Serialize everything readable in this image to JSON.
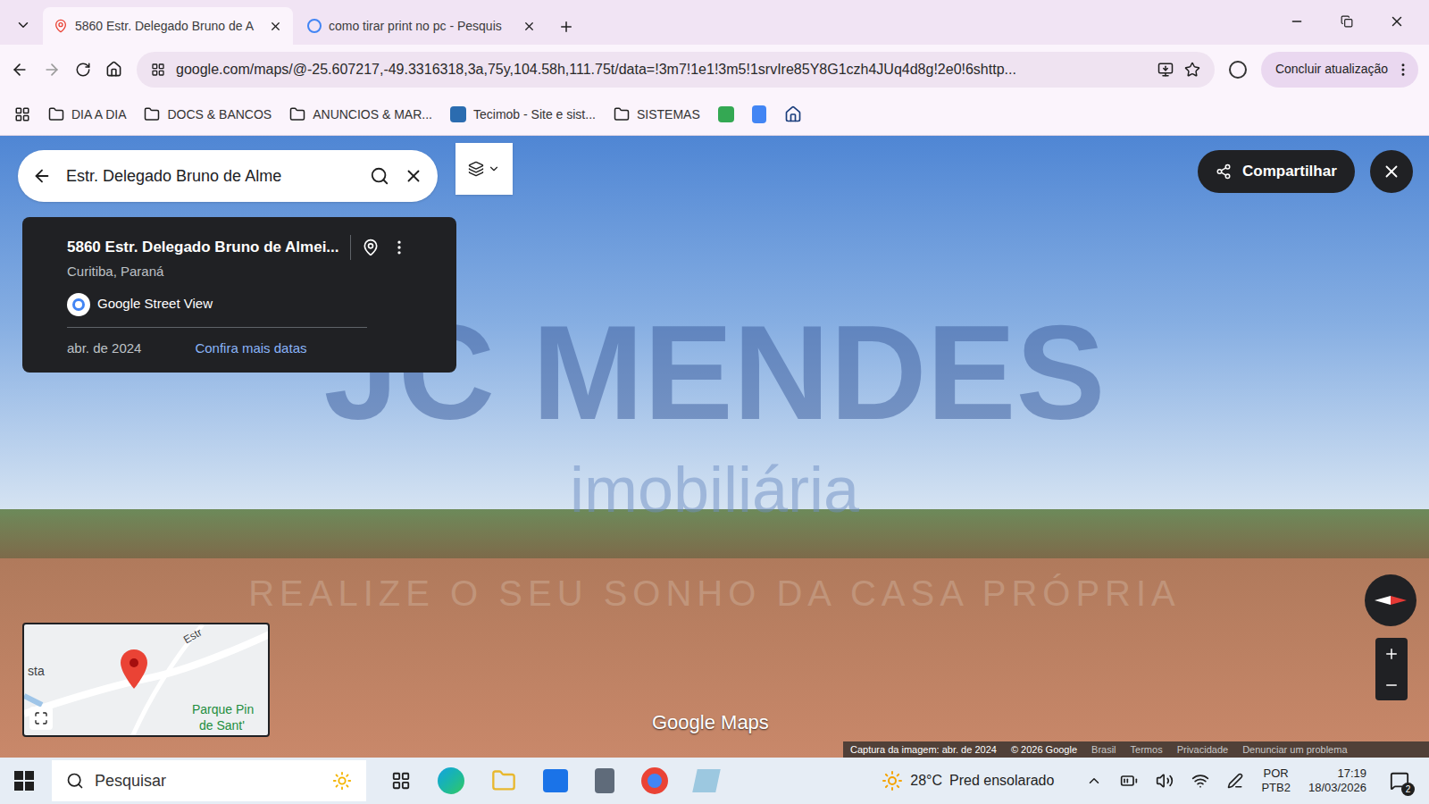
{
  "browser": {
    "tabs": [
      {
        "label": "5860 Estr. Delegado Bruno de A",
        "selected": true
      },
      {
        "label": "como tirar print no pc - Pesquis",
        "selected": false
      }
    ],
    "url": "google.com/maps/@-25.607217,-49.3316318,3a,75y,104.58h,111.75t/data=!3m7!1e1!3m5!1srvIre85Y8G1czh4JUq4d8g!2e0!6shttp...",
    "update_button": "Concluir atualização",
    "bookmarks": [
      {
        "label": "DIA A DIA",
        "kind": "folder"
      },
      {
        "label": "DOCS & BANCOS",
        "kind": "folder"
      },
      {
        "label": "ANUNCIOS & MAR...",
        "kind": "folder"
      },
      {
        "label": "Tecimob - Site e sist...",
        "kind": "site"
      },
      {
        "label": "SISTEMAS",
        "kind": "folder"
      }
    ]
  },
  "maps": {
    "search_value": "Estr. Delegado Bruno de Alme",
    "card": {
      "title": "5860 Estr. Delegado Bruno de Almei...",
      "subtitle": "Curitiba, Paraná",
      "source": "Google Street View",
      "date": "abr. de 2024",
      "link": "Confira mais datas"
    },
    "share_button": "Compartilhar",
    "minimap_labels": [
      "sta",
      "Estr",
      "Parque Pin",
      "de Sant'"
    ],
    "logo": "Google Maps",
    "footer": [
      "Captura da imagem: abr. de 2024",
      "© 2026 Google",
      "Brasil",
      "Termos",
      "Privacidade",
      "Denunciar um problema"
    ]
  },
  "watermark": {
    "brand": "JC MENDES",
    "sub": "imobiliária",
    "slogan": "REALIZE O SEU SONHO DA CASA PRÓPRIA"
  },
  "taskbar": {
    "search_placeholder": "Pesquisar",
    "temperature": "28°C",
    "weather": "Pred ensolarado",
    "language": "POR",
    "layout": "PTB2",
    "time": "17:19",
    "date": "18/03/2026",
    "notifications": "2"
  }
}
